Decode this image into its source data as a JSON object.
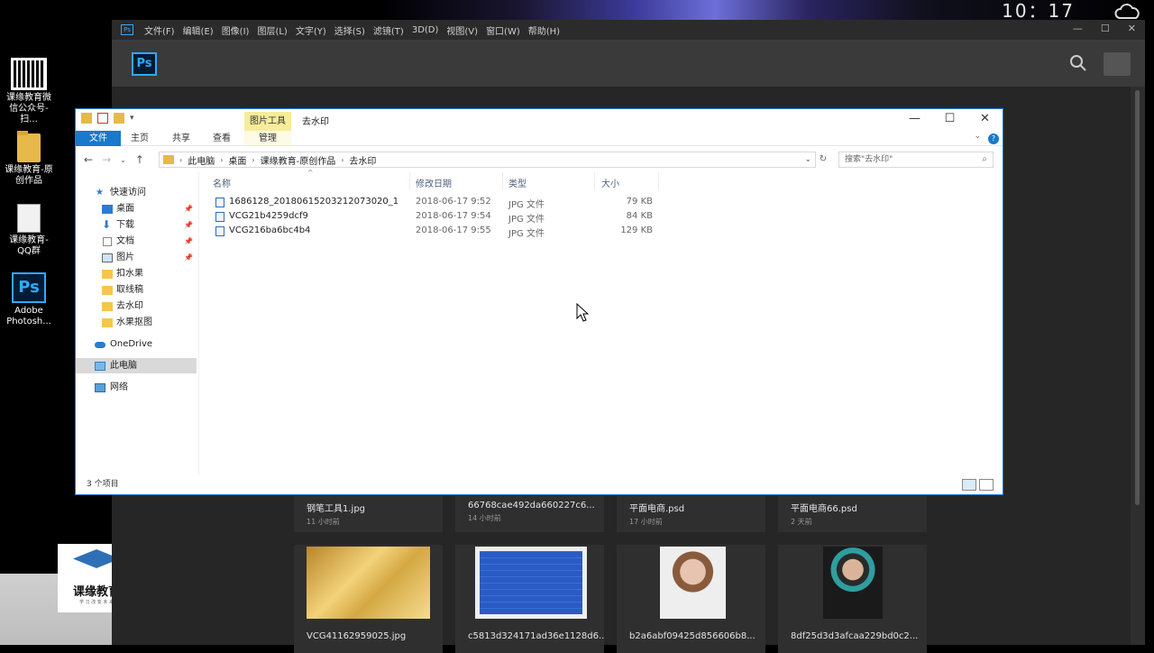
{
  "desktop": {
    "clock": "10：17",
    "icons": [
      {
        "label": "课缘教育微信公众号-扫...",
        "icon": "qr-code-icon"
      },
      {
        "label": "课缘教育-原创作品",
        "icon": "folder-icon"
      },
      {
        "label": "课缘教育-QQ群",
        "icon": "document-icon"
      },
      {
        "label": "Adobe Photosh...",
        "icon": "photoshop-icon",
        "badge": "Ps"
      }
    ],
    "logo_text": "课缘教育",
    "logo_subtext": "学 习 改 变 未 来"
  },
  "photoshop": {
    "app_badge": "Ps",
    "menu": [
      "文件(F)",
      "编辑(E)",
      "图像(I)",
      "图层(L)",
      "文字(Y)",
      "选择(S)",
      "滤镜(T)",
      "3D(D)",
      "视图(V)",
      "窗口(W)",
      "帮助(H)"
    ],
    "window_controls": [
      "—",
      "☐",
      "✕"
    ],
    "recent_files": [
      {
        "name": "钢笔工具1.jpg",
        "time": "11 小时前"
      },
      {
        "name": "66768cae492da660227c6...",
        "time": "14 小时前"
      },
      {
        "name": "平面电商.psd",
        "time": "17 小时前"
      },
      {
        "name": "平面电商66.psd",
        "time": "2 天前"
      }
    ],
    "thumbnails": [
      {
        "name": "VCG41162959025.jpg"
      },
      {
        "name": "c5813d324171ad36e1128d6..."
      },
      {
        "name": "b2a6abf09425d856606b8..."
      },
      {
        "name": "8df25d3d3afcaa229bd0c2..."
      }
    ]
  },
  "explorer": {
    "title": "去水印",
    "context_tab": "图片工具",
    "ribbon_tabs": [
      "文件",
      "主页",
      "共享",
      "查看",
      "管理"
    ],
    "path": [
      "此电脑",
      "桌面",
      "课缘教育-原创作品",
      "去水印"
    ],
    "search_placeholder": "搜索\"去水印\"",
    "nav": {
      "quick_access": "快速访问",
      "items": [
        "桌面",
        "下载",
        "文档",
        "图片",
        "扣水果",
        "取线稿",
        "去水印",
        "水果抠图"
      ],
      "onedrive": "OneDrive",
      "this_pc": "此电脑",
      "network": "网络"
    },
    "columns": {
      "name": "名称",
      "date": "修改日期",
      "type": "类型",
      "size": "大小"
    },
    "files": [
      {
        "name": "1686128_20180615203212073020_1",
        "date": "2018-06-17 9:52",
        "type": "JPG 文件",
        "size": "79 KB"
      },
      {
        "name": "VCG21b4259dcf9",
        "date": "2018-06-17 9:54",
        "type": "JPG 文件",
        "size": "84 KB"
      },
      {
        "name": "VCG216ba6bc4b4",
        "date": "2018-06-17 9:55",
        "type": "JPG 文件",
        "size": "129 KB"
      }
    ],
    "status": "3 个项目"
  }
}
